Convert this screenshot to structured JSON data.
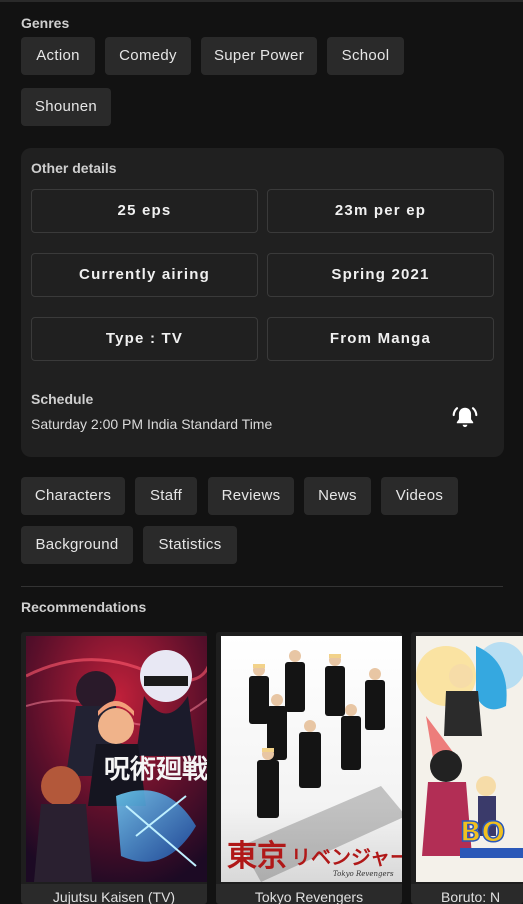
{
  "genres": {
    "title": "Genres",
    "items": [
      "Action",
      "Comedy",
      "Super Power",
      "School",
      "Shounen"
    ]
  },
  "details": {
    "title": "Other details",
    "items": [
      "25 eps",
      "23m per ep",
      "Currently airing",
      "Spring 2021",
      "Type : TV",
      "From Manga"
    ],
    "schedule_label": "Schedule",
    "schedule_text": "Saturday 2:00 PM India Standard Time",
    "bell_icon": "bell-alert-icon"
  },
  "tabs": {
    "items": [
      "Characters",
      "Staff",
      "Reviews",
      "News",
      "Videos",
      "Background",
      "Statistics"
    ]
  },
  "recommendations": {
    "title": "Recommendations",
    "items": [
      {
        "title": "Jujutsu Kaisen (TV)"
      },
      {
        "title": "Tokyo Revengers"
      },
      {
        "title": "Boruto: N"
      }
    ]
  },
  "colors": {
    "background": "#121212",
    "chip": "#2a2a2a",
    "card": "#202020"
  }
}
